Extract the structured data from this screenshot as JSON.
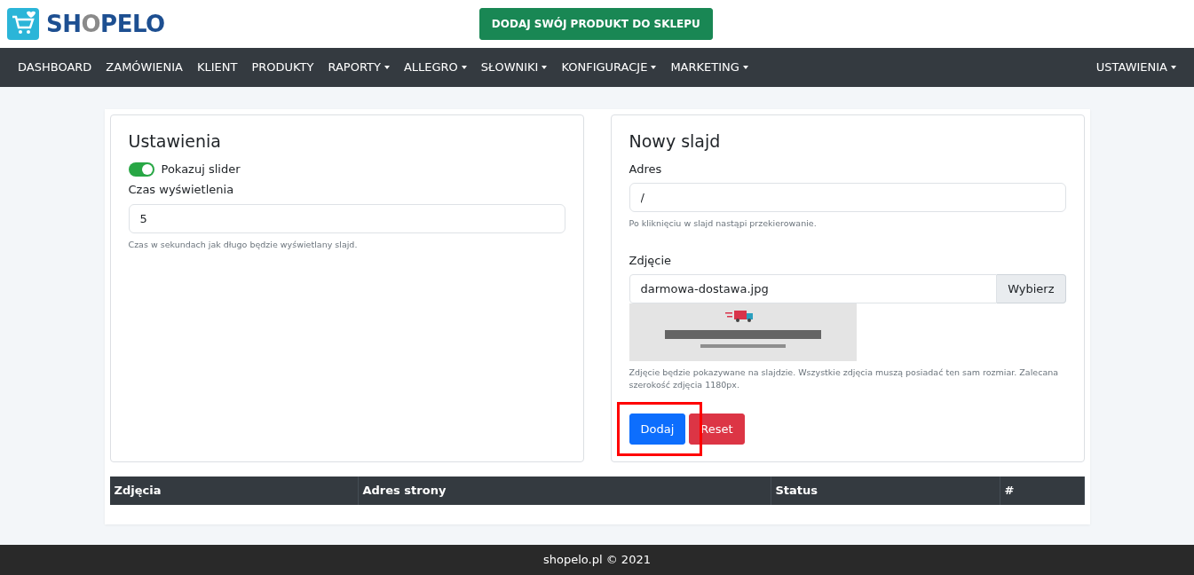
{
  "header": {
    "logo": [
      {
        "text": "SH",
        "color": "#1d4f91"
      },
      {
        "text": "O",
        "color": "#8a8a8a"
      },
      {
        "text": "PELO",
        "color": "#1d4f91"
      }
    ],
    "cta": "DODAJ SWÓJ PRODUKT DO SKLEPU"
  },
  "nav": {
    "items": [
      {
        "label": "DASHBOARD",
        "dropdown": false
      },
      {
        "label": "ZAMÓWIENIA",
        "dropdown": false
      },
      {
        "label": "KLIENT",
        "dropdown": false
      },
      {
        "label": "PRODUKTY",
        "dropdown": false
      },
      {
        "label": "RAPORTY",
        "dropdown": true
      },
      {
        "label": "ALLEGRO",
        "dropdown": true
      },
      {
        "label": "SŁOWNIKI",
        "dropdown": true
      },
      {
        "label": "KONFIGURACJE",
        "dropdown": true
      },
      {
        "label": "MARKETING",
        "dropdown": true
      }
    ],
    "right": {
      "label": "USTAWIENIA",
      "dropdown": true
    }
  },
  "settings": {
    "title": "Ustawienia",
    "toggle": {
      "label": "Pokazuj slider",
      "on": true
    },
    "duration": {
      "label": "Czas wyświetlenia",
      "value": "5",
      "help": "Czas w sekundach jak długo będzie wyświetlany slajd."
    }
  },
  "new_slide": {
    "title": "Nowy slajd",
    "address": {
      "label": "Adres",
      "value": "/",
      "help": "Po kliknięciu w slajd nastąpi przekierowanie."
    },
    "image": {
      "label": "Zdjęcie",
      "file": "darmowa-dostawa.jpg",
      "browse": "Wybierz",
      "help": "Zdjęcie będzie pokazywane na slajdzie. Wszystkie zdjęcia muszą posiadać ten sam rozmiar. Zalecana szerokość zdjęcia 1180px."
    },
    "buttons": [
      {
        "label": "Dodaj",
        "kind": "primary",
        "highlighted": true
      },
      {
        "label": "Reset",
        "kind": "danger",
        "highlighted": false
      }
    ]
  },
  "table": {
    "columns": [
      "Zdjęcia",
      "Adres strony",
      "Status",
      "#"
    ]
  },
  "footer": "shopelo.pl © 2021"
}
